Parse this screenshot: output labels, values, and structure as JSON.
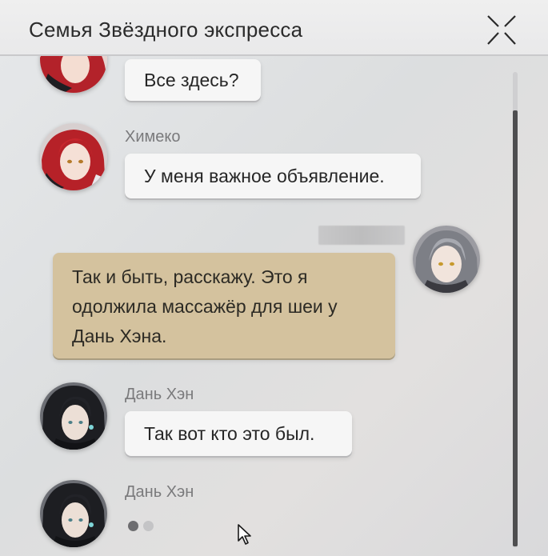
{
  "window": {
    "title": "Семья Звёздного экспресса",
    "close_icon": "close-x-icon"
  },
  "messages": [
    {
      "sender": "",
      "avatar": "himeko-avatar",
      "text": "Все здесь?",
      "own": false
    },
    {
      "sender": "Химеко",
      "avatar": "himeko-avatar",
      "text": "У меня важное объявление.",
      "own": false
    },
    {
      "sender": "",
      "avatar": "trailblazer-avatar",
      "text_lines": [
        "Так и быть, расскажу. Это я",
        "одолжила массажёр для шеи у",
        "Дань Хэна."
      ],
      "own": true,
      "sender_hidden": true
    },
    {
      "sender": "Дань Хэн",
      "avatar": "dan-heng-avatar",
      "text": "Так вот кто это был.",
      "own": false
    },
    {
      "sender": "Дань Хэн",
      "avatar": "dan-heng-avatar",
      "typing": true,
      "own": false
    }
  ],
  "colors": {
    "own_bubble": "#d4c29e",
    "other_bubble": "#f6f6f6",
    "scroll_thumb": "#4e4e50"
  }
}
